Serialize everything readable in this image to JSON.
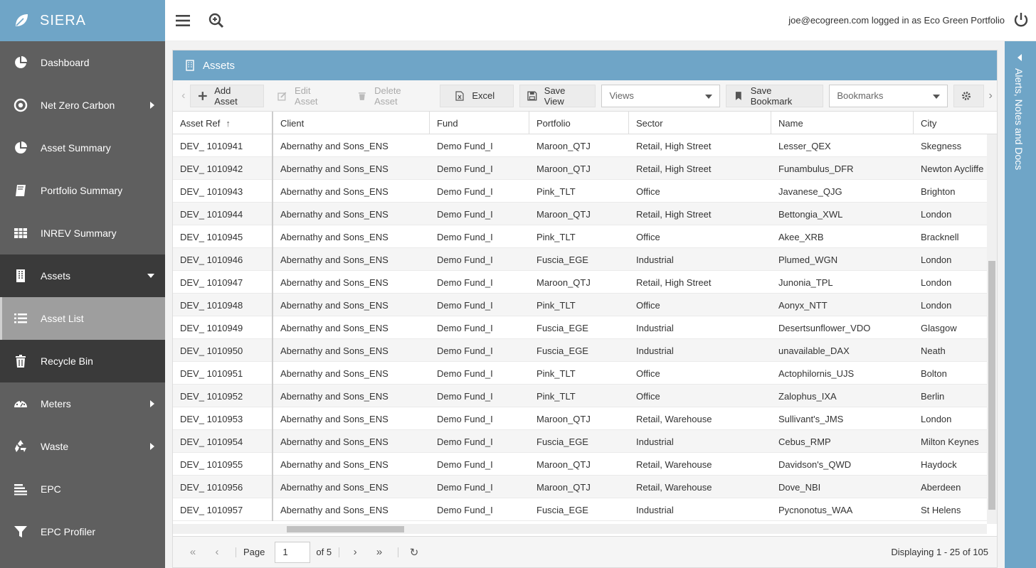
{
  "app": {
    "title": "SIERA"
  },
  "sidebar": {
    "items": [
      {
        "label": "Dashboard",
        "icon": "pie-chart-icon"
      },
      {
        "label": "Net Zero Carbon",
        "icon": "target-icon"
      },
      {
        "label": "Asset Summary",
        "icon": "pie-chart-icon"
      },
      {
        "label": "Portfolio Summary",
        "icon": "book-icon"
      },
      {
        "label": "INREV Summary",
        "icon": "table-icon"
      },
      {
        "label": "Assets",
        "icon": "building-icon"
      },
      {
        "label": "Asset List",
        "icon": "list-icon"
      },
      {
        "label": "Recycle Bin",
        "icon": "trash-icon"
      },
      {
        "label": "Meters",
        "icon": "dashboard-gauge-icon"
      },
      {
        "label": "Waste",
        "icon": "recycle-icon"
      },
      {
        "label": "EPC",
        "icon": "bars-icon"
      },
      {
        "label": "EPC Profiler",
        "icon": "filter-icon"
      }
    ]
  },
  "topbar": {
    "user_text": "joe@ecogreen.com logged in as Eco Green Portfolio"
  },
  "panel": {
    "title": "Assets"
  },
  "toolbar": {
    "add_asset": "Add Asset",
    "edit_asset": "Edit Asset",
    "delete_asset": "Delete Asset",
    "excel": "Excel",
    "save_view": "Save View",
    "views_placeholder": "Views",
    "save_bookmark": "Save Bookmark",
    "bookmarks_placeholder": "Bookmarks"
  },
  "grid": {
    "columns": [
      "Asset Ref",
      "Client",
      "Fund",
      "Portfolio",
      "Sector",
      "Name",
      "City"
    ],
    "rows": [
      [
        "DEV_ 1010941",
        "Abernathy and Sons_ENS",
        "Demo Fund_I",
        "Maroon_QTJ",
        "Retail, High Street",
        "Lesser_QEX",
        "Skegness"
      ],
      [
        "DEV_ 1010942",
        "Abernathy and Sons_ENS",
        "Demo Fund_I",
        "Maroon_QTJ",
        "Retail, High Street",
        "Funambulus_DFR",
        "Newton Aycliffe"
      ],
      [
        "DEV_ 1010943",
        "Abernathy and Sons_ENS",
        "Demo Fund_I",
        "Pink_TLT",
        "Office",
        "Javanese_QJG",
        "Brighton"
      ],
      [
        "DEV_ 1010944",
        "Abernathy and Sons_ENS",
        "Demo Fund_I",
        "Maroon_QTJ",
        "Retail, High Street",
        "Bettongia_XWL",
        "London"
      ],
      [
        "DEV_ 1010945",
        "Abernathy and Sons_ENS",
        "Demo Fund_I",
        "Pink_TLT",
        "Office",
        "Akee_XRB",
        "Bracknell"
      ],
      [
        "DEV_ 1010946",
        "Abernathy and Sons_ENS",
        "Demo Fund_I",
        "Fuscia_EGE",
        "Industrial",
        "Plumed_WGN",
        "London"
      ],
      [
        "DEV_ 1010947",
        "Abernathy and Sons_ENS",
        "Demo Fund_I",
        "Maroon_QTJ",
        "Retail, High Street",
        "Junonia_TPL",
        "London"
      ],
      [
        "DEV_ 1010948",
        "Abernathy and Sons_ENS",
        "Demo Fund_I",
        "Pink_TLT",
        "Office",
        "Aonyx_NTT",
        "London"
      ],
      [
        "DEV_ 1010949",
        "Abernathy and Sons_ENS",
        "Demo Fund_I",
        "Fuscia_EGE",
        "Industrial",
        "Desertsunflower_VDO",
        "Glasgow"
      ],
      [
        "DEV_ 1010950",
        "Abernathy and Sons_ENS",
        "Demo Fund_I",
        "Fuscia_EGE",
        "Industrial",
        "unavailable_DAX",
        "Neath"
      ],
      [
        "DEV_ 1010951",
        "Abernathy and Sons_ENS",
        "Demo Fund_I",
        "Pink_TLT",
        "Office",
        "Actophilornis_UJS",
        "Bolton"
      ],
      [
        "DEV_ 1010952",
        "Abernathy and Sons_ENS",
        "Demo Fund_I",
        "Pink_TLT",
        "Office",
        "Zalophus_IXA",
        "Berlin"
      ],
      [
        "DEV_ 1010953",
        "Abernathy and Sons_ENS",
        "Demo Fund_I",
        "Maroon_QTJ",
        "Retail, Warehouse",
        "Sullivant's_JMS",
        "London"
      ],
      [
        "DEV_ 1010954",
        "Abernathy and Sons_ENS",
        "Demo Fund_I",
        "Fuscia_EGE",
        "Industrial",
        "Cebus_RMP",
        "Milton Keynes"
      ],
      [
        "DEV_ 1010955",
        "Abernathy and Sons_ENS",
        "Demo Fund_I",
        "Maroon_QTJ",
        "Retail, Warehouse",
        "Davidson's_QWD",
        "Haydock"
      ],
      [
        "DEV_ 1010956",
        "Abernathy and Sons_ENS",
        "Demo Fund_I",
        "Maroon_QTJ",
        "Retail, Warehouse",
        "Dove_NBI",
        "Aberdeen"
      ],
      [
        "DEV_ 1010957",
        "Abernathy and Sons_ENS",
        "Demo Fund_I",
        "Fuscia_EGE",
        "Industrial",
        "Pycnonotus_WAA",
        "St Helens"
      ]
    ]
  },
  "pager": {
    "page_label": "Page",
    "page_value": "1",
    "of_label": "of 5",
    "display_info": "Displaying 1 - 25 of 105"
  },
  "rightbar": {
    "label": "Alerts, Notes and Docs"
  },
  "colors": {
    "brand": "#6fa5c7",
    "sidebar": "#5f5f5f",
    "sidebar_active": "#3a3a3a",
    "sidebar_selected": "#9e9e9e"
  }
}
